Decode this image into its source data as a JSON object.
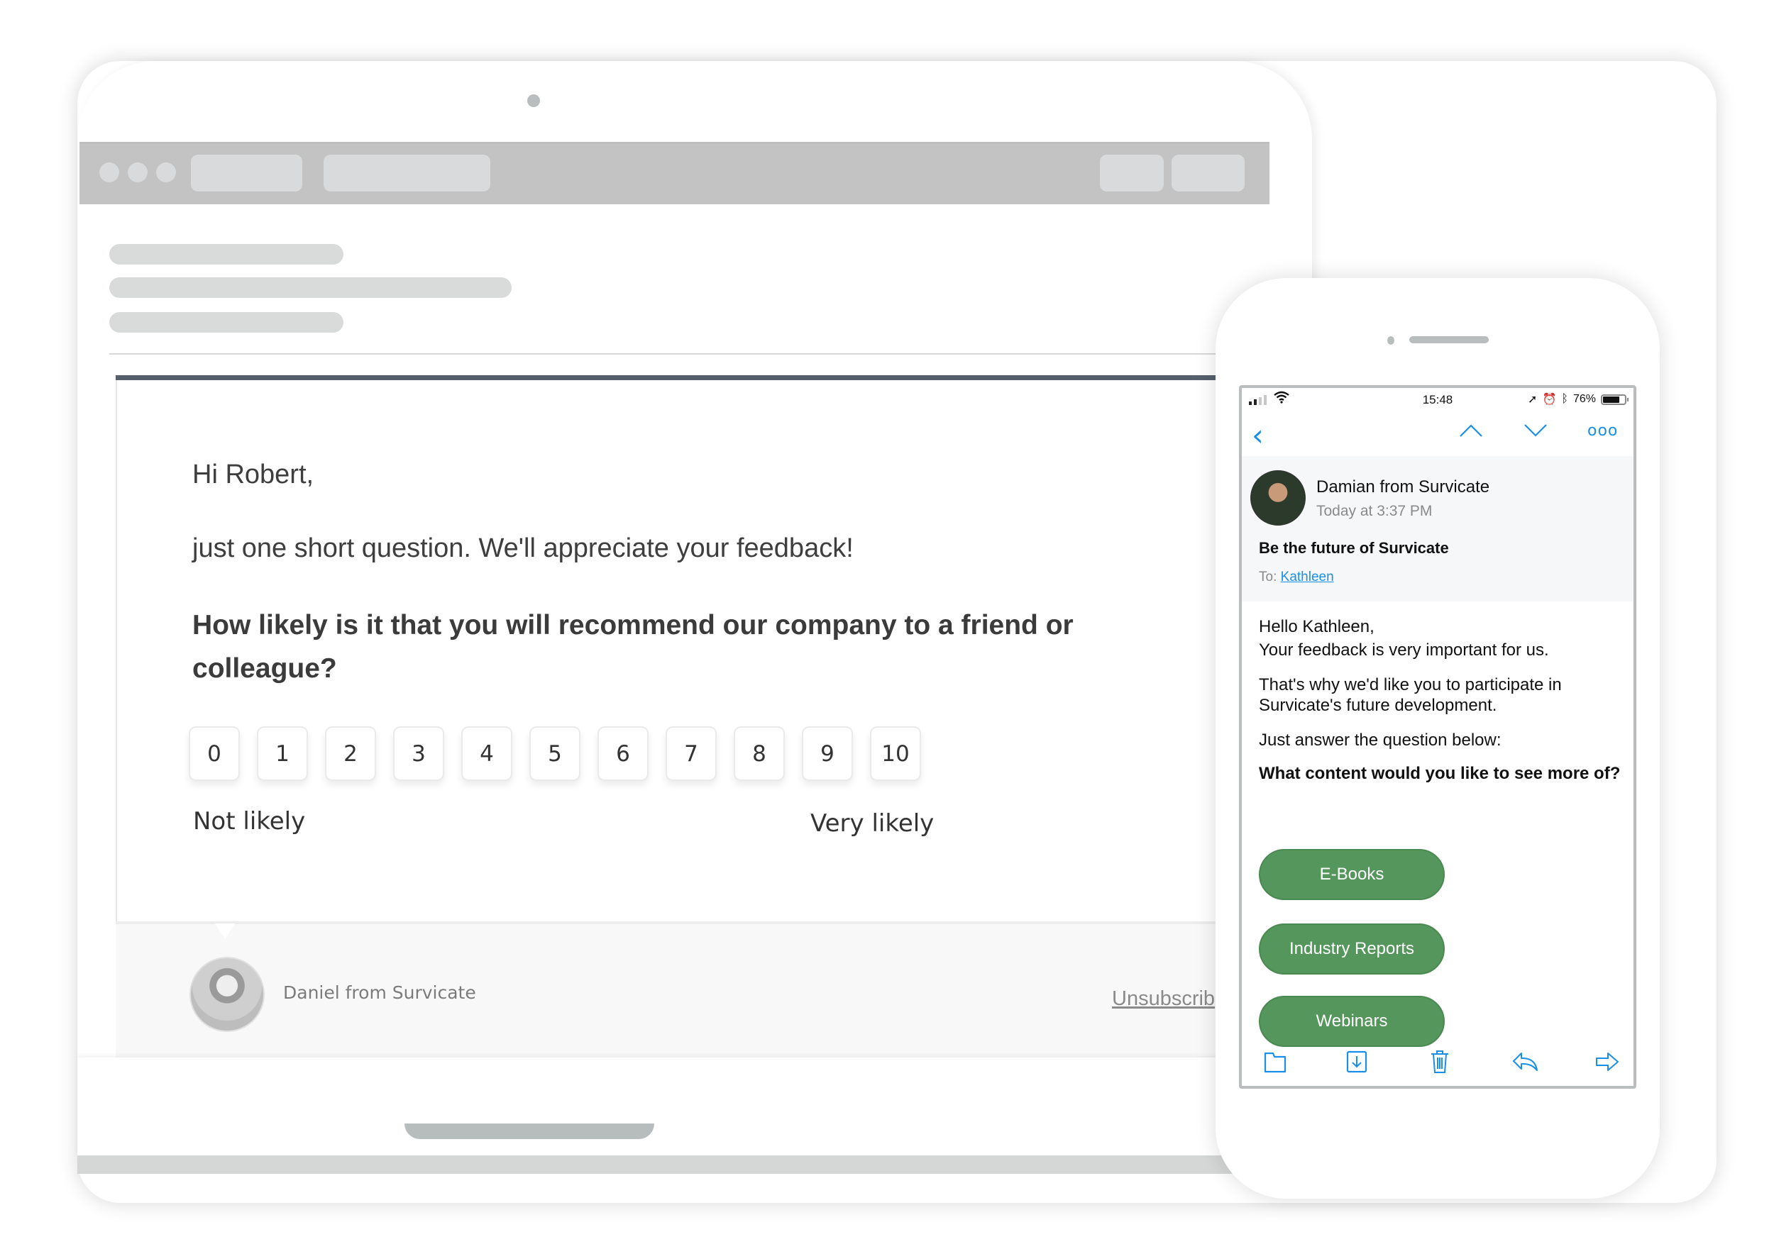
{
  "laptop": {
    "email": {
      "greeting": "Hi Robert,",
      "intro": "just one short question. We'll appreciate your feedback!",
      "question": "How likely is it that you will recommend our company to a friend or colleague?",
      "nps_scale": [
        "0",
        "1",
        "2",
        "3",
        "4",
        "5",
        "6",
        "7",
        "8",
        "9",
        "10"
      ],
      "scale_low_label": "Not likely",
      "scale_high_label": "Very likely",
      "footer": {
        "sender_name": "Daniel from Survicate",
        "unsubscribe_label": "Unsubscrib"
      }
    }
  },
  "phone": {
    "status_bar": {
      "time": "15:48",
      "battery_percent": "76%",
      "battery_level": 0.76,
      "icons": [
        "signal-icon",
        "wifi-icon",
        "location-icon",
        "alarm-icon",
        "bluetooth-icon",
        "battery-icon"
      ]
    },
    "nav": {
      "back_icon": "chevron-left-icon",
      "prev_icon": "chevron-up-icon",
      "next_icon": "chevron-down-icon",
      "more_icon": "more-icon",
      "more_glyph": "ooo"
    },
    "mail": {
      "from": "Damian from Survicate",
      "time": "Today at 3:37 PM",
      "subject": "Be the future of Survicate",
      "to_label": "To:",
      "to_name": "Kathleen",
      "body": {
        "line1": "Hello Kathleen,",
        "line2": "Your feedback is very important for us.",
        "para2": "That's why we'd like you to participate in Survicate's future development.",
        "para3": "Just answer the question below:",
        "question": "What content would you like to see more of?"
      },
      "choices": [
        "E-Books",
        "Industry Reports",
        "Webinars"
      ]
    },
    "toolbar": [
      "folder-icon",
      "archive-icon",
      "trash-icon",
      "reply-icon",
      "forward-icon"
    ],
    "accent_color": "#1a8fea",
    "button_color": "#55965c"
  }
}
